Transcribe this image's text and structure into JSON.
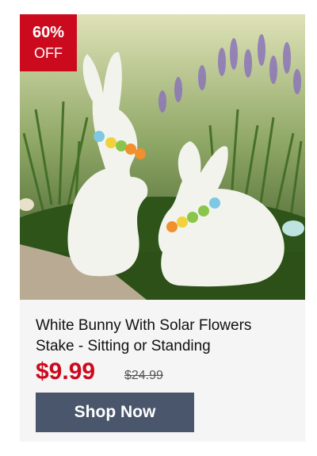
{
  "product": {
    "discount": {
      "percent": "60%",
      "label": "OFF"
    },
    "title": "White Bunny With Solar Flowers Stake - Sitting or Standing",
    "price": "$9.99",
    "original_price": "$24.99",
    "cta_label": "Shop Now"
  },
  "colors": {
    "badge": "#cc0a1e",
    "price": "#cc0a1e",
    "button": "#4a566b",
    "card_background": "#f5f5f5"
  }
}
